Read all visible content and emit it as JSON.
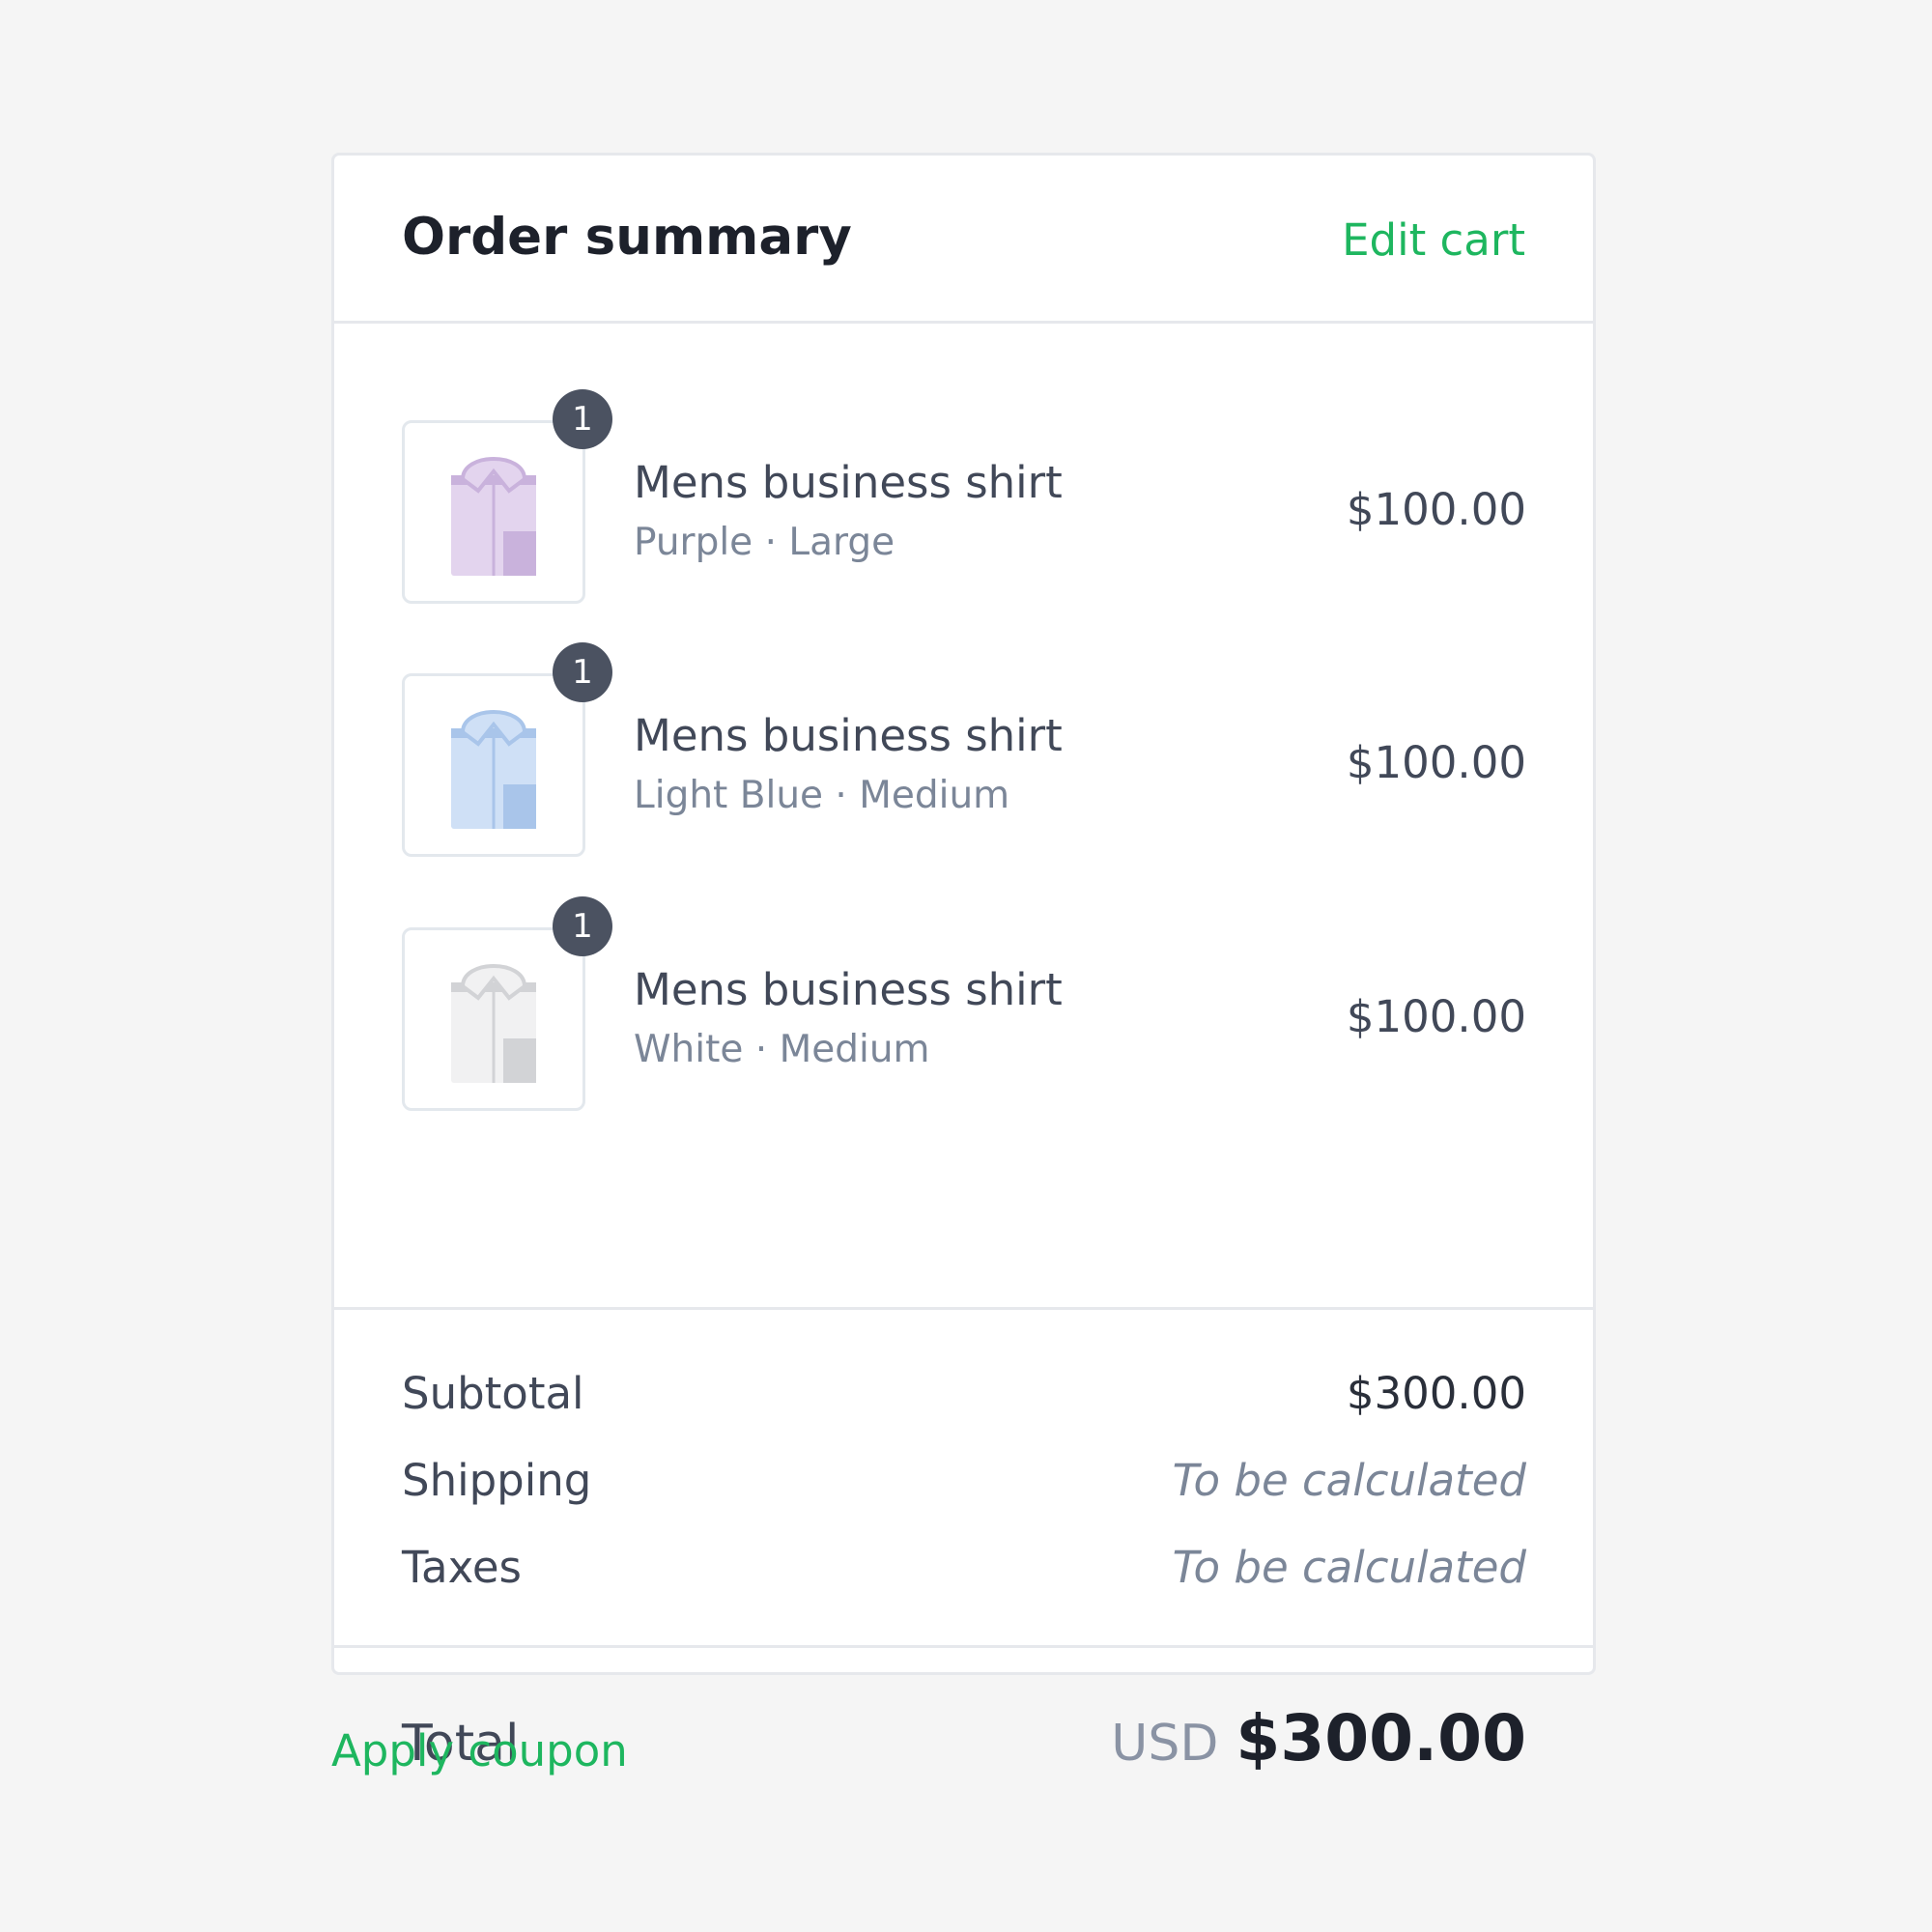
{
  "header": {
    "title": "Order summary",
    "edit_cart_label": "Edit cart"
  },
  "items": [
    {
      "name": "Mens business shirt",
      "variant": "Purple · Large",
      "price": "$100.00",
      "quantity": "1",
      "shirt_color": "#e3d4ee",
      "shirt_shade": "#c9b2dc"
    },
    {
      "name": "Mens business shirt",
      "variant": "Light Blue · Medium",
      "price": "$100.00",
      "quantity": "1",
      "shirt_color": "#cfe0f6",
      "shirt_shade": "#a9c5ea"
    },
    {
      "name": "Mens business shirt",
      "variant": "White · Medium",
      "price": "$100.00",
      "quantity": "1",
      "shirt_color": "#f1f1f2",
      "shirt_shade": "#d2d3d6"
    }
  ],
  "totals": {
    "subtotal_label": "Subtotal",
    "subtotal_value": "$300.00",
    "shipping_label": "Shipping",
    "shipping_value": "To be calculated",
    "taxes_label": "Taxes",
    "taxes_value": "To be calculated"
  },
  "total": {
    "label": "Total",
    "currency": "USD",
    "amount": "$300.00"
  },
  "coupon": {
    "label": "Apply coupon"
  },
  "colors": {
    "accent": "#1eb65f",
    "badge": "#4b5261"
  },
  "icons": {
    "product_image": "folded-shirt-icon"
  }
}
